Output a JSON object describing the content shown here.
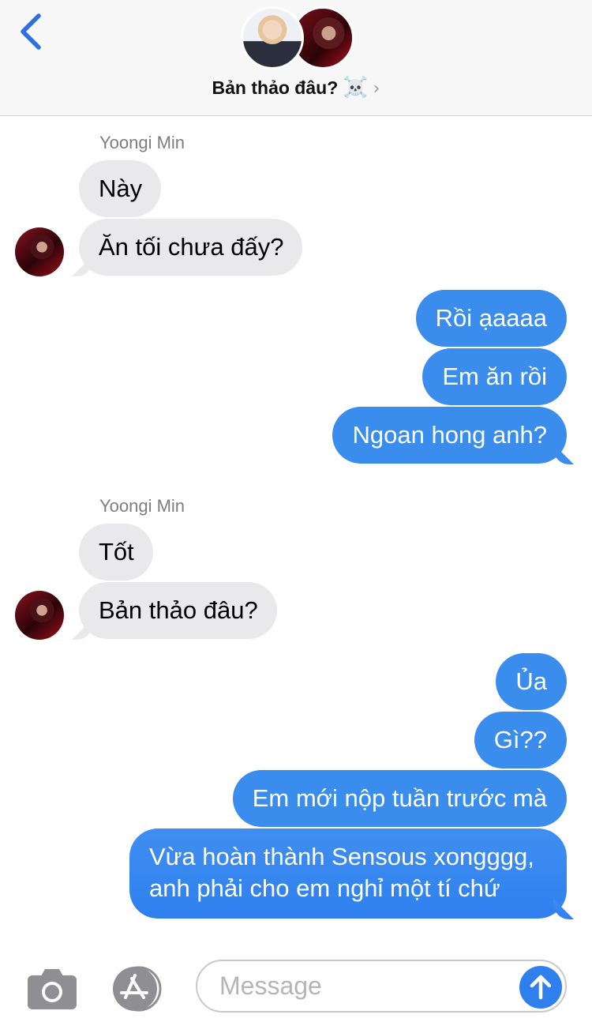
{
  "header": {
    "title": "Bản thảo đâu?",
    "title_emoji": "☠️",
    "chevron": "›",
    "back_icon": "chevron-left-icon",
    "accent": "#2f6fe0"
  },
  "messages": [
    {
      "side": "incoming",
      "sender": "Yoongi Min"
    },
    {
      "side": "incoming",
      "text": "Này"
    },
    {
      "side": "incoming",
      "text": "Ăn tối chưa đấy?"
    },
    {
      "side": "outgoing",
      "text": "Rồi ạaaaa"
    },
    {
      "side": "outgoing",
      "text": "Em ăn rồi"
    },
    {
      "side": "outgoing",
      "text": "Ngoan hong anh?"
    },
    {
      "side": "incoming",
      "sender": "Yoongi Min"
    },
    {
      "side": "incoming",
      "text": "Tốt"
    },
    {
      "side": "incoming",
      "text": "Bản thảo đâu?"
    },
    {
      "side": "outgoing",
      "text": "Ủa"
    },
    {
      "side": "outgoing",
      "text": "Gì??"
    },
    {
      "side": "outgoing",
      "text": "Em mới nộp tuần trước mà"
    },
    {
      "side": "outgoing",
      "text": "Vừa hoàn thành Sensous xongggg, anh phải cho em nghỉ một tí chứ"
    }
  ],
  "composer": {
    "placeholder": "Message",
    "camera_icon": "camera-icon",
    "apps_icon": "app-store-icon",
    "send_icon": "arrow-up-icon"
  },
  "colors": {
    "incoming_bubble": "#e9e9eb",
    "outgoing_bubble": "#3a8dec",
    "send_button": "#2f80ed"
  }
}
